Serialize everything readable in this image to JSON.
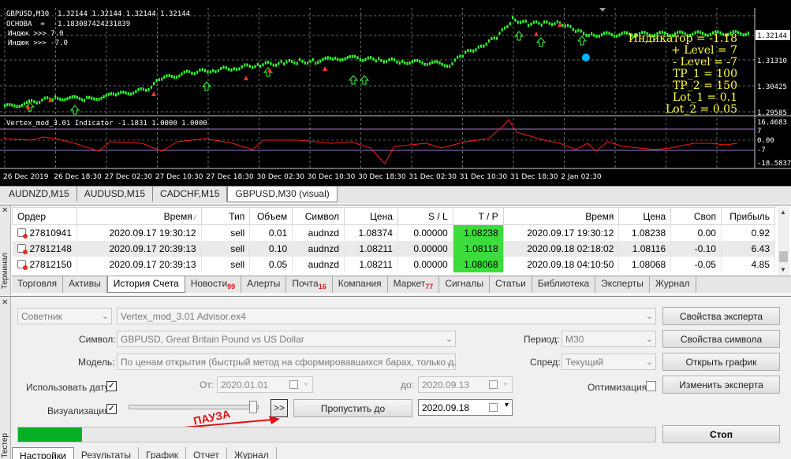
{
  "chart": {
    "info_lines": [
      "GBPUSD,M30  1.32144 1.32144 1.32144 1.32144",
      "OCHOBA  =  -1.183087424231839",
      "Индюк >>> 7.0",
      "Индюк >>> -7.0"
    ],
    "indicator_panel": [
      "Индикатор = -1.18",
      "+ Level = 7",
      "- Level = -7",
      "TP_1 = 100",
      "TP_2 = 150",
      "Lot_1 = 0.1",
      "Lot_2 = 0.05"
    ],
    "price_labels": [
      "1.32144",
      "1.31310",
      "1.30425",
      "1.29585"
    ],
    "sub_title": "Vertex_mod_3.01 Indicator -1.1831 1.0000 1.0000",
    "sub_labels": [
      "16.4683",
      "7",
      "0.00",
      "-7",
      "-18.5837"
    ],
    "time_labels": [
      "26 Dec 2019",
      "26 Dec 18:30",
      "27 Dec 02:30",
      "27 Dec 10:30",
      "27 Dec 18:30",
      "30 Dec 02:30",
      "30 Dec 10:30",
      "30 Dec 18:30",
      "31 Dec 02:30",
      "31 Dec 10:30",
      "31 Dec 18:30",
      "2 Jan 02:30"
    ],
    "colors": {
      "background": "#000000",
      "candle": "#33ff33",
      "arrow_up": "#33ff33",
      "arrow_down": "#ff3333",
      "indicator": "#ff1a1a",
      "level": "#a07ad8",
      "text": "#ffff40"
    }
  },
  "chart_tabs": [
    "AUDNZD,M15",
    "AUDUSD,M15",
    "CADCHF,M15",
    "GBPUSD,M30 (visual)"
  ],
  "terminal": {
    "side_label": "Терминал",
    "columns": [
      "Ордер",
      "Время",
      "Тип",
      "Объем",
      "Символ",
      "Цена",
      "S / L",
      "T / P",
      "Время",
      "Цена",
      "Своп",
      "Прибыль"
    ],
    "rows": [
      [
        "27810941",
        "2020.09.17 19:30:12",
        "sell",
        "0.01",
        "audnzd",
        "1.08374",
        "0.00000",
        "1.08238",
        "2020.09.17 19:30:12",
        "1.08238",
        "0.00",
        "0.92"
      ],
      [
        "27812148",
        "2020.09.17 20:39:13",
        "sell",
        "0.10",
        "audnzd",
        "1.08211",
        "0.00000",
        "1.08118",
        "2020.09.18 02:18:02",
        "1.08116",
        "-0.10",
        "6.43"
      ],
      [
        "27812150",
        "2020.09.17 20:39:13",
        "sell",
        "0.05",
        "audnzd",
        "1.08211",
        "0.00000",
        "1.08068",
        "2020.09.18 04:10:50",
        "1.08068",
        "-0.05",
        "4.85"
      ]
    ],
    "tabs": [
      {
        "label": "Торговля",
        "badge": ""
      },
      {
        "label": "Активы",
        "badge": ""
      },
      {
        "label": "История Счета",
        "badge": ""
      },
      {
        "label": "Новости",
        "badge": "99"
      },
      {
        "label": "Алерты",
        "badge": ""
      },
      {
        "label": "Почта",
        "badge": "16"
      },
      {
        "label": "Компания",
        "badge": ""
      },
      {
        "label": "Маркет",
        "badge": "77"
      },
      {
        "label": "Сигналы",
        "badge": ""
      },
      {
        "label": "Статьи",
        "badge": ""
      },
      {
        "label": "Библиотека",
        "badge": ""
      },
      {
        "label": "Эксперты",
        "badge": ""
      },
      {
        "label": "Журнал",
        "badge": ""
      }
    ],
    "active_tab": "История Счета"
  },
  "tester": {
    "side_label": "Тестер",
    "type_value": "Советник",
    "expert_value": "Vertex_mod_3.01 Advisor.ex4",
    "symbol_label": "Символ:",
    "symbol_value": "GBPUSD, Great Britain Pound vs US Dollar",
    "model_label": "Модель:",
    "model_value": "По ценам открытия (быстрый метод на сформировавшихся барах, только для с",
    "period_label": "Период:",
    "period_value": "M30",
    "spread_label": "Спред:",
    "spread_value": "Текущий",
    "use_date_label": "Использовать дату",
    "use_date_checked": true,
    "from_label": "От:",
    "from_value": "2020.01.01",
    "to_label": "до:",
    "to_value": "2020.09.13",
    "optimize_label": "Оптимизация",
    "optimize_checked": false,
    "visual_label": "Визуализация",
    "visual_checked": true,
    "pause_button": ">>",
    "skip_button": "Пропустить до",
    "skip_date": "2020.09.18",
    "pause_annotation": "ПАУЗА",
    "progress": 0.1,
    "buttons": {
      "expert_props": "Свойства эксперта",
      "symbol_props": "Свойства символа",
      "open_chart": "Открыть график",
      "modify_expert": "Изменить эксперта",
      "stop": "Стоп"
    },
    "tabs": [
      "Настройки",
      "Результаты",
      "График",
      "Отчет",
      "Журнал"
    ],
    "active_tab": "Настройки"
  }
}
